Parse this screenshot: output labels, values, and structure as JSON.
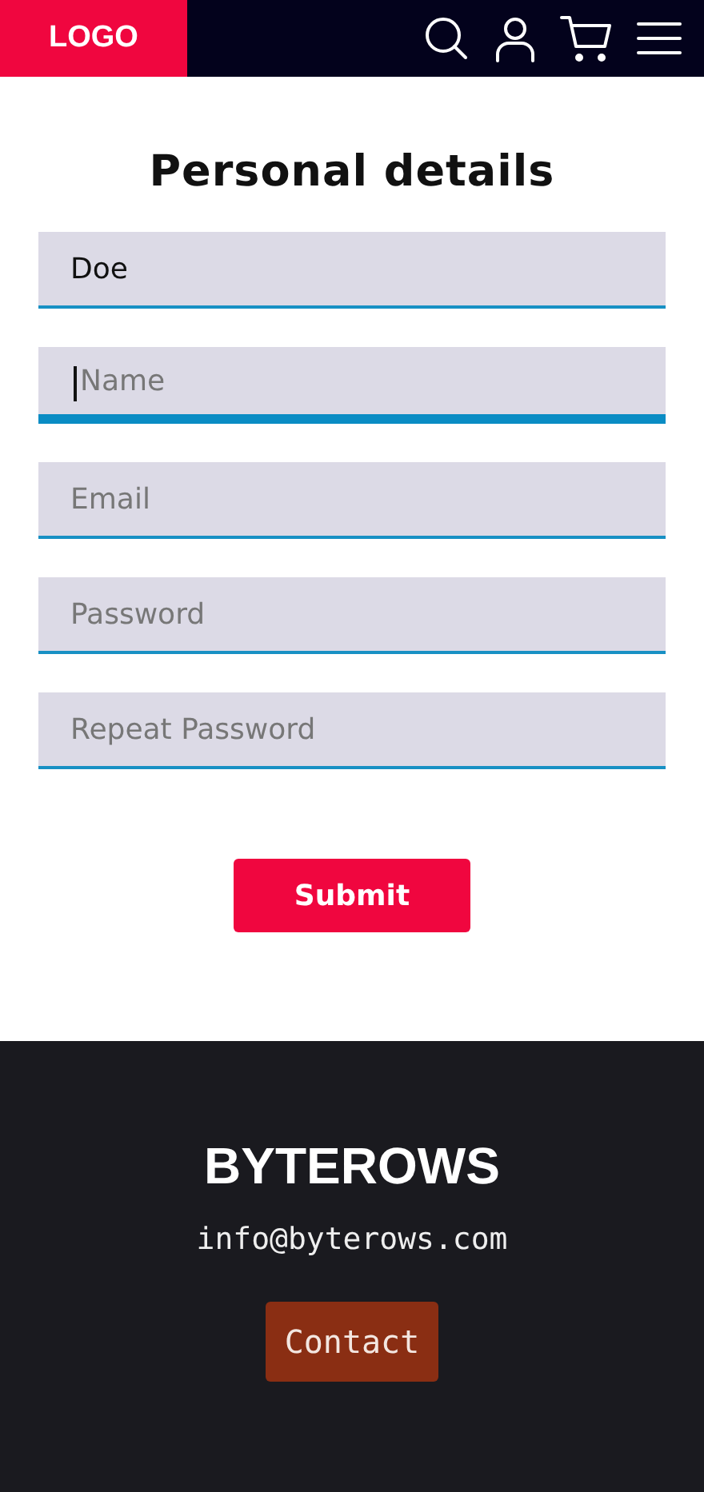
{
  "header": {
    "logo": "LOGO"
  },
  "form": {
    "title": "Personal details",
    "fields": [
      {
        "value": "Doe",
        "focused": false
      },
      {
        "placeholder": "Name",
        "focused": true
      },
      {
        "placeholder": "Email",
        "focused": false
      },
      {
        "placeholder": "Password",
        "focused": false
      },
      {
        "placeholder": "Repeat Password",
        "focused": false
      }
    ],
    "submit": "Submit"
  },
  "footer": {
    "brand": "BYTEROWS",
    "email": "info@byterows.com",
    "contact": "Contact"
  }
}
